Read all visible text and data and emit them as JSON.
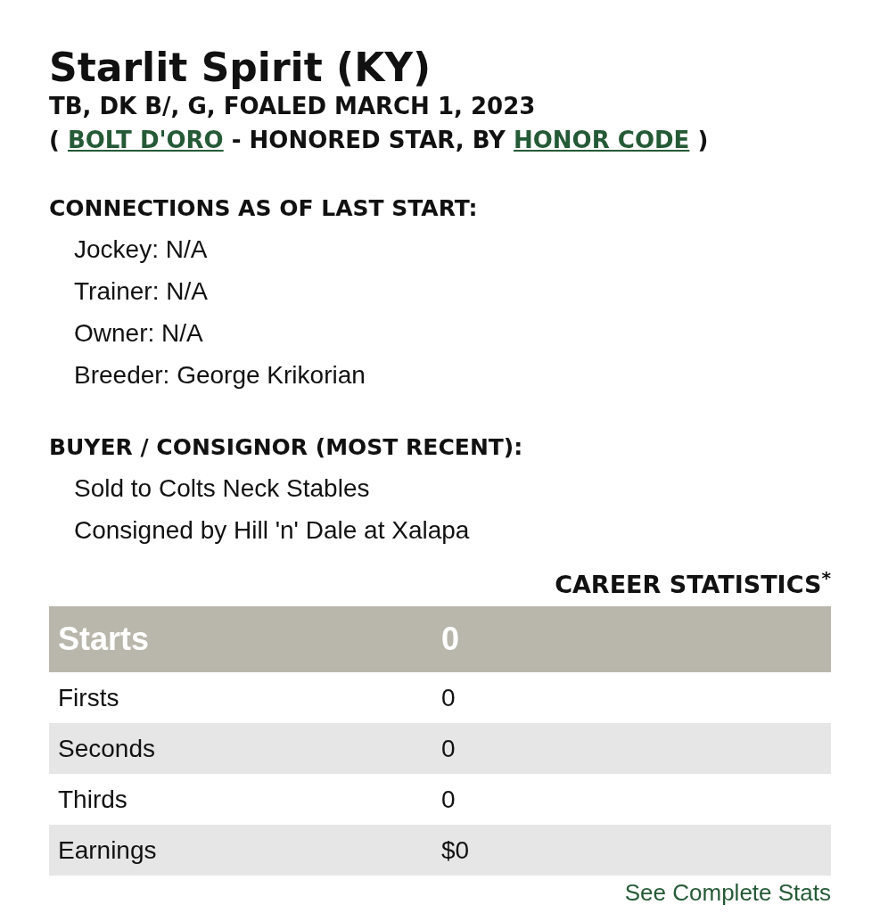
{
  "horse": {
    "name": "Starlit Spirit (KY)",
    "details": "TB, DK B/, G, FOALED MARCH 1, 2023",
    "pedigree": {
      "open": "(",
      "sire": "BOLT D'ORO",
      "middle": "- HONORED STAR, BY",
      "damsire": "HONOR CODE",
      "close": ")"
    }
  },
  "sections": [
    {
      "heading": "CONNECTIONS AS OF LAST START:",
      "items": [
        "Jockey: N/A",
        "Trainer: N/A",
        "Owner: N/A",
        "Breeder: George Krikorian"
      ]
    },
    {
      "heading": "BUYER / CONSIGNOR (MOST RECENT):",
      "items": [
        "Sold to Colts Neck Stables",
        "Consigned by Hill 'n' Dale at Xalapa"
      ]
    }
  ],
  "career_statistics": {
    "title": "CAREER STATISTICS$^{*}$",
    "header": {
      "label": "Starts",
      "value": "0"
    },
    "rows": [
      {
        "label": "Firsts",
        "value": "0"
      },
      {
        "label": "Seconds",
        "value": "0"
      },
      {
        "label": "Thirds",
        "value": "0"
      },
      {
        "label": "Earnings",
        "value": "$0"
      }
    ],
    "link": "See Complete Stats"
  }
}
